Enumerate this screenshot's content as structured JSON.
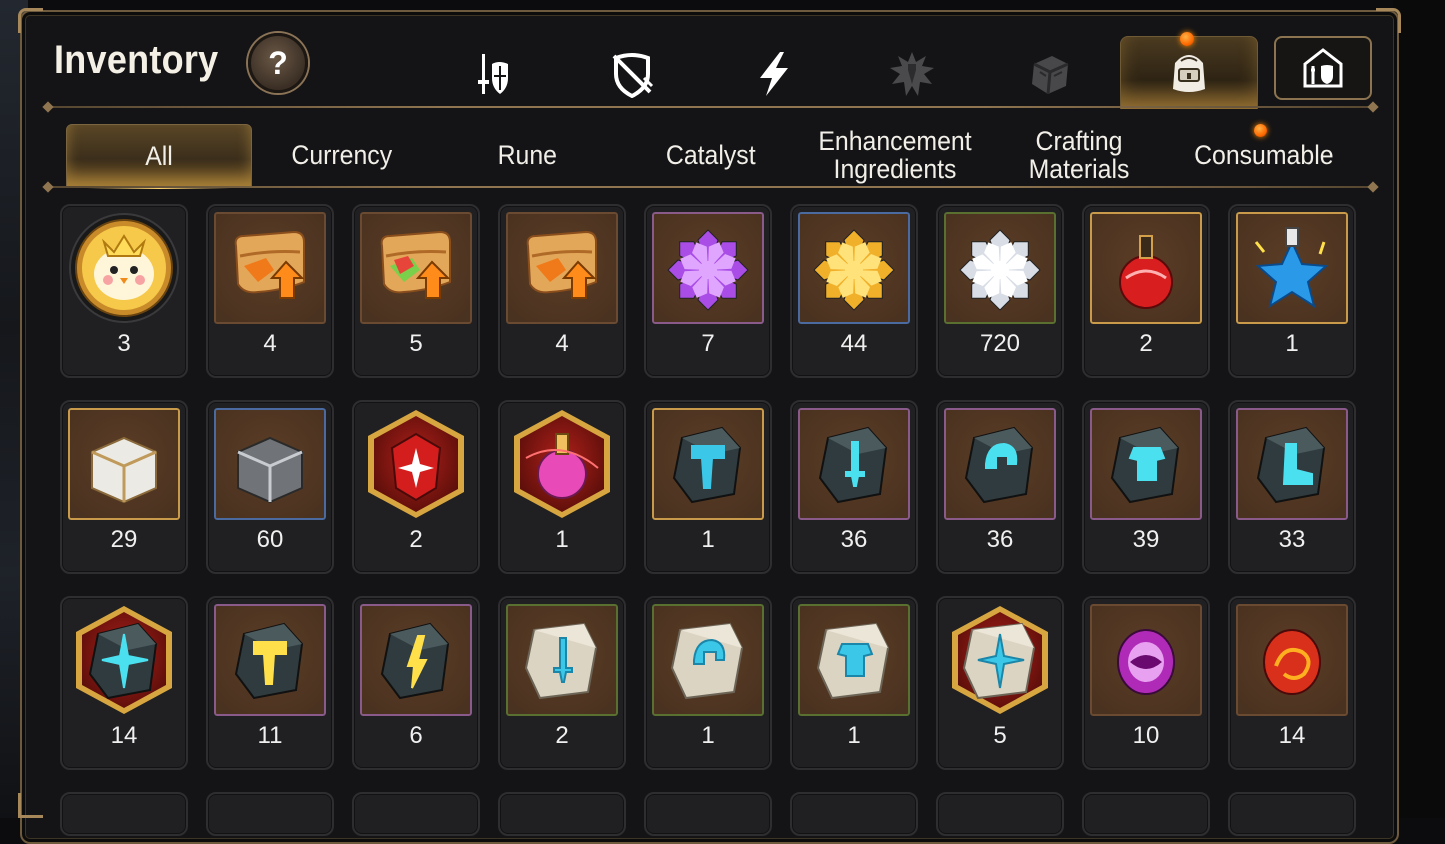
{
  "title": "Inventory",
  "help_label": "?",
  "category_icons": [
    {
      "name": "equipment-icon"
    },
    {
      "name": "artifact-icon"
    },
    {
      "name": "lightning-icon"
    },
    {
      "name": "special-icon"
    },
    {
      "name": "exclusive-box-icon"
    },
    {
      "name": "backpack-icon",
      "active": true,
      "notification": true
    },
    {
      "name": "storage-icon"
    }
  ],
  "tabs": [
    {
      "label": "All",
      "active": true
    },
    {
      "label": "Currency"
    },
    {
      "label": "Rune"
    },
    {
      "label": "Catalyst"
    },
    {
      "label": "Enhancement Ingredients"
    },
    {
      "label": "Crafting Materials"
    },
    {
      "label": "Consumable",
      "notification": true
    }
  ],
  "items": [
    [
      {
        "icon": "chick-token-icon",
        "count": "3"
      },
      {
        "icon": "orange-scroll-upgrade-icon",
        "count": "4"
      },
      {
        "icon": "rainbow-scroll-upgrade-icon",
        "count": "5"
      },
      {
        "icon": "orange-scroll-upgrade-icon",
        "count": "4"
      },
      {
        "icon": "purple-crystal-flower-icon",
        "count": "7"
      },
      {
        "icon": "gold-crystal-flower-icon",
        "count": "44"
      },
      {
        "icon": "silver-crystal-flower-icon",
        "count": "720"
      },
      {
        "icon": "red-potion-icon",
        "count": "2"
      },
      {
        "icon": "blue-star-potion-icon",
        "count": "1"
      }
    ],
    [
      {
        "icon": "white-gold-chest-icon",
        "count": "29"
      },
      {
        "icon": "silver-chest-icon",
        "count": "60"
      },
      {
        "icon": "red-gem-hexagon-icon",
        "count": "2"
      },
      {
        "icon": "pink-potion-hexagon-icon",
        "count": "1"
      },
      {
        "icon": "hammer-stone-icon",
        "count": "1"
      },
      {
        "icon": "sword-rune-stone-icon",
        "count": "36"
      },
      {
        "icon": "helmet-rune-stone-icon",
        "count": "36"
      },
      {
        "icon": "armor-rune-stone-icon",
        "count": "39"
      },
      {
        "icon": "boot-rune-stone-icon",
        "count": "33"
      }
    ],
    [
      {
        "icon": "cross-rune-stone-hexagon-icon",
        "count": "14"
      },
      {
        "icon": "hammer-rune-stone-icon",
        "count": "11"
      },
      {
        "icon": "bolt-rune-stone-icon",
        "count": "6"
      },
      {
        "icon": "sword-stone-tablet-icon",
        "count": "2"
      },
      {
        "icon": "helmet-stone-tablet-icon",
        "count": "1"
      },
      {
        "icon": "armor-stone-tablet-icon",
        "count": "1"
      },
      {
        "icon": "cross-stone-tablet-hexagon-icon",
        "count": "5"
      },
      {
        "icon": "purple-eye-orb-icon",
        "count": "10"
      },
      {
        "icon": "red-swirl-orb-icon",
        "count": "14"
      }
    ]
  ],
  "colors": {
    "accent_gold": "#8f7550",
    "tab_active": "#5a4626",
    "slot_bg": "#202022",
    "frame_purple": "#5c2a55",
    "frame_red": "#7a2216",
    "frame_blue": "#243650",
    "frame_green": "#2c3d1e",
    "frame_brown": "#4a3220"
  }
}
